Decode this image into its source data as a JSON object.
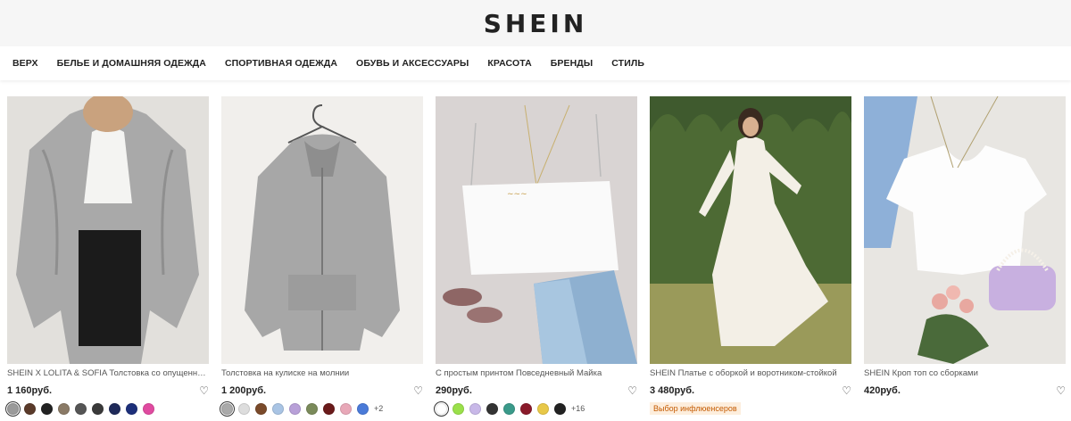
{
  "header": {
    "logo": "SHEIN"
  },
  "nav": [
    "ВЕРХ",
    "БЕЛЬЕ И ДОМАШНЯЯ ОДЕЖДА",
    "СПОРТИВНАЯ ОДЕЖДА",
    "ОБУВЬ И АКСЕССУАРЫ",
    "КРАСОТА",
    "БРЕНДЫ",
    "СТИЛЬ"
  ],
  "products": [
    {
      "title": "SHEIN X LOLITA & SOFIA Толстовка со опущенным р...",
      "price": "1 160руб.",
      "swatches": [
        "#9a9a9a",
        "#5a3a2a",
        "#222222",
        "#8a7a66",
        "#555555",
        "#3a3a3a",
        "#1f2a5a",
        "#1c2f7a",
        "#e04aa0"
      ],
      "more": "",
      "badge": ""
    },
    {
      "title": "Толстовка на кулиске на молнии",
      "price": "1 200руб.",
      "swatches": [
        "#aaaaaa",
        "#dddddd",
        "#7a4a2a",
        "#a9c4e4",
        "#b8a0d8",
        "#7a8a5a",
        "#6a1a1a",
        "#e8a8b8",
        "#4a7ad8"
      ],
      "more": "+2",
      "badge": ""
    },
    {
      "title": "С простым принтом Повседневный Майка",
      "price": "290руб.",
      "swatches": [
        "#ffffff",
        "#9ae04a",
        "#c8b8e8",
        "#333333",
        "#3a9a8a",
        "#8a1a2a",
        "#e8c848",
        "#222222"
      ],
      "more": "+16",
      "badge": ""
    },
    {
      "title": "SHEIN Платье с оборкой и воротником-стойкой",
      "price": "3 480руб.",
      "swatches": [],
      "more": "",
      "badge": "Выбор инфлюенсеров"
    },
    {
      "title": "SHEIN Кроп топ со сборками",
      "price": "420руб.",
      "swatches": [],
      "more": "",
      "badge": ""
    }
  ],
  "colors": {
    "header_bg": "#f6f6f6",
    "badge_text": "#c45a00",
    "badge_bg": "#fdeedd"
  }
}
